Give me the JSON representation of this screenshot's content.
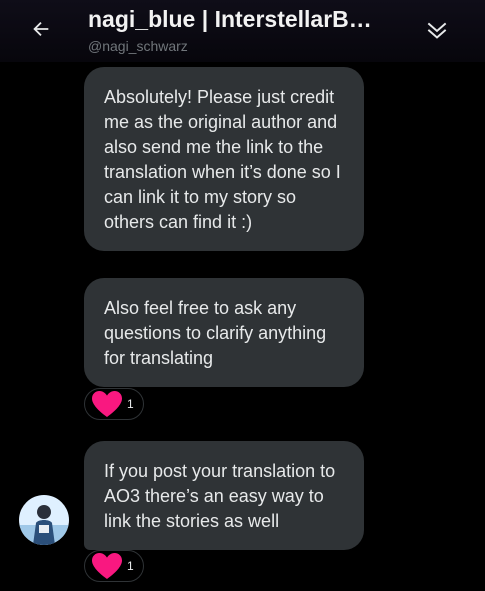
{
  "header": {
    "title": "nagi_blue | InterstellarB…",
    "handle": "@nagi_schwarz"
  },
  "icons": {
    "back": "back-arrow-icon",
    "collapse": "double-chevron-down-icon",
    "reaction": "heart-icon"
  },
  "messages": [
    {
      "text": "Absolutely! Please just credit me as the original author and also send me the link to the translation when it’s done so I can link it to my story so others can find it :)"
    },
    {
      "text": "Also feel free to ask any questions to clarify anything for translating",
      "reaction_count": "1"
    },
    {
      "text": "If you post your translation to AO3 there’s an easy way to link the stories as well",
      "reaction_count": "1"
    }
  ],
  "colors": {
    "background": "#000000",
    "bubble": "#2f3336",
    "heart": "#f91880",
    "text": "#e7e9ea",
    "muted": "#71767b"
  }
}
